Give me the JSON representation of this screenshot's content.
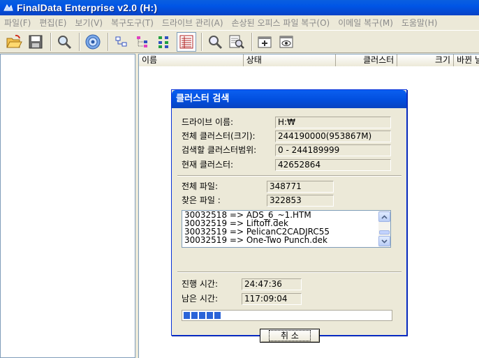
{
  "window": {
    "title": "FinalData Enterprise v2.0 (H:)"
  },
  "menu": [
    "파일(F)",
    "편집(E)",
    "보기(V)",
    "복구도구(T)",
    "드라이브 관리(A)",
    "손상된 오피스 파일 복구(O)",
    "이메일 복구(M)",
    "도움말(H)"
  ],
  "toolbar": {
    "icons": [
      "open-folder-icon",
      "save-icon",
      "search-icon",
      "settings-gear-icon",
      "tree-small-icon",
      "tree-branch-icon",
      "tree-list-icon",
      "list-view-icon",
      "magnify-icon",
      "zoom-page-icon",
      "window-add-icon",
      "preview-eye-icon"
    ]
  },
  "list": {
    "columns": {
      "name": "이름",
      "status": "상태",
      "cluster": "클러스터",
      "size": "크기",
      "date": "바뀐 날짜"
    }
  },
  "dialog": {
    "title": "클러스터 검색",
    "drive_label": "드라이브 이름:",
    "drive_value": "H:₩",
    "total_cluster_label": "전체 클러스터(크기):",
    "total_cluster_value": "244190000(953867M)",
    "search_range_label": "검색할 클러스터범위:",
    "search_range_value": "0 - 244189999",
    "current_cluster_label": "현재 클러스터:",
    "current_cluster_value": "42652864",
    "total_files_label": "전체 파일:",
    "total_files_value": "348771",
    "found_files_label": "찾은 파일 :",
    "found_files_value": "322853",
    "log": [
      "30032518 => ADS_6_~1.HTM",
      "30032519 => Liftoff.dek",
      "30032519 => PelicanC2CADJRC55",
      "30032519 => One-Two Punch.dek"
    ],
    "elapsed_label": "진행 시간:",
    "elapsed_value": "24:47:36",
    "remaining_label": "남은 시간:",
    "remaining_value": "117:09:04",
    "progress": 0.17,
    "cancel_label": "취 소"
  }
}
